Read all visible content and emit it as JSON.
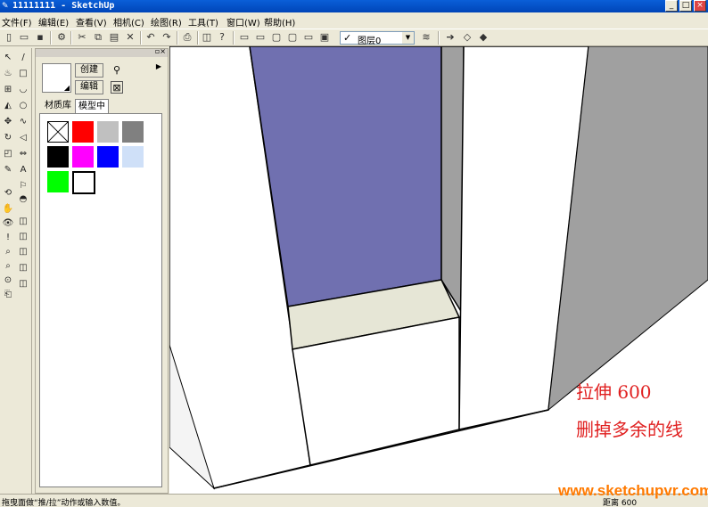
{
  "window": {
    "title": "11111111 - SketchUp"
  },
  "menu": [
    "文件(F)",
    "编辑(E)",
    "查看(V)",
    "相机(C)",
    "绘图(R)",
    "工具(T)",
    "窗口(W)",
    "帮助(H)"
  ],
  "toolbar": {
    "layer_value": "图层0"
  },
  "materials": {
    "create_label": "创建",
    "edit_label": "编辑",
    "tabs": [
      "材质库",
      "模型中"
    ],
    "active_tab": 1,
    "swatches": [
      {
        "name": "default",
        "color": "#ffffff"
      },
      {
        "name": "red",
        "color": "#ff0000"
      },
      {
        "name": "light-gray",
        "color": "#c0c0c0"
      },
      {
        "name": "gray",
        "color": "#808080"
      },
      {
        "name": "black",
        "color": "#000000"
      },
      {
        "name": "magenta",
        "color": "#ff00ff"
      },
      {
        "name": "blue",
        "color": "#0000ff"
      },
      {
        "name": "translucent-blue",
        "color": "#cfe0f8"
      },
      {
        "name": "green",
        "color": "#00ff00"
      },
      {
        "name": "white",
        "color": "#ffffff"
      }
    ]
  },
  "annotation": {
    "line1": "拉伸 600",
    "line2": "删掉多余的线"
  },
  "status": {
    "hint": "拖曳面做“推/拉”动作或输入数值。",
    "measure": "距离 600"
  },
  "watermark": "www.sketchupvr.com",
  "colors": {
    "window_blue": "#7070b0",
    "face_gray": "#a0a0a0",
    "ledge": "#e6e6d6"
  }
}
